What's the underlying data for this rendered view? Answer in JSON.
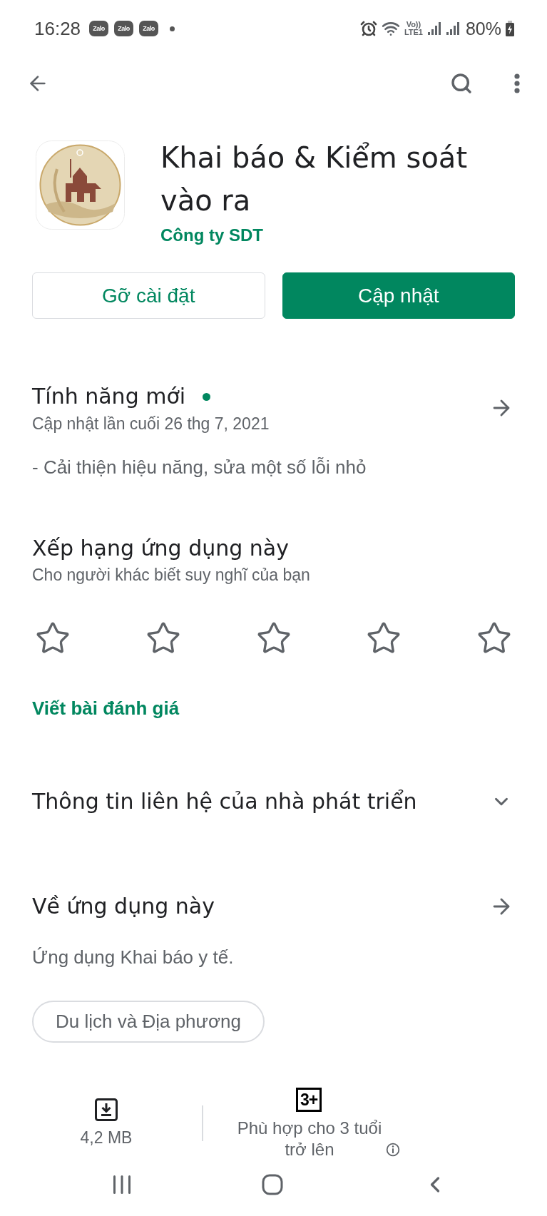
{
  "status_bar": {
    "time": "16:28",
    "notifications": [
      {
        "app": "Zalo"
      },
      {
        "app": "Zalo"
      },
      {
        "app": "Zalo"
      }
    ],
    "network": [
      "Vo))",
      "LTE1"
    ],
    "battery": "80%"
  },
  "app": {
    "title": "Khai báo & Kiểm soát vào ra",
    "developer": "Công ty SDT"
  },
  "buttons": [
    {
      "label": "Gỡ cài đặt",
      "kind": "outline"
    },
    {
      "label": "Cập nhật",
      "kind": "filled"
    }
  ],
  "whats_new": {
    "title": "Tính năng mới",
    "new_dot": true,
    "updated": "Cập nhật lần cuối 26 thg 7, 2021",
    "notes": "- Cải thiện hiệu năng, sửa một số lỗi nhỏ"
  },
  "rate": {
    "title": "Xếp hạng ứng dụng này",
    "subtitle": "Cho người khác biết suy nghĩ của bạn",
    "stars": 0,
    "write_review": "Viết bài đánh giá"
  },
  "developer_contact": {
    "title": "Thông tin liên hệ của nhà phát triển",
    "expanded": false
  },
  "about": {
    "title": "Về ứng dụng này",
    "description": "Ứng dụng Khai báo y tế.",
    "tags": [
      "Du lịch và Địa phương"
    ]
  },
  "stats": [
    {
      "kind": "download",
      "value": "4,2 MB"
    },
    {
      "kind": "rating",
      "badge": "3+",
      "value": "Phù hợp cho 3 tuổi trở lên"
    }
  ]
}
